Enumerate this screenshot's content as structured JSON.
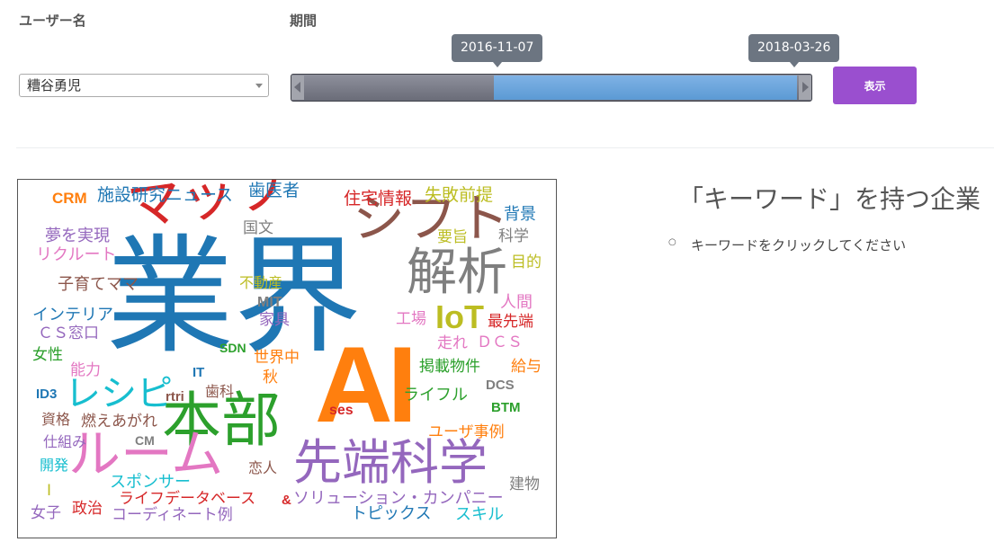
{
  "form": {
    "user_label": "ユーザー名",
    "user_value": "糟谷勇児",
    "period_label": "期間",
    "period_start": "2016-11-07",
    "period_end": "2018-03-26",
    "show_button": "表示"
  },
  "colors": {
    "button": "#9a4fcf",
    "slider_range": "#5b9ad4"
  },
  "panel": {
    "title": "「キーワード」を持つ企業",
    "hint": "キーワードをクリックしてください"
  },
  "cloud_words": [
    {
      "id": "w0",
      "text": "業界",
      "color": "#1f77b4"
    },
    {
      "id": "w1",
      "text": "AI",
      "color": "#ff7f0e"
    },
    {
      "id": "w2",
      "text": "マップ",
      "color": "#d62728"
    },
    {
      "id": "w3",
      "text": "シフト",
      "color": "#8c564b"
    },
    {
      "id": "w4",
      "text": "解析",
      "color": "#7f7f7f"
    },
    {
      "id": "w5",
      "text": "本部",
      "color": "#2ca02c"
    },
    {
      "id": "w6",
      "text": "ルーム",
      "color": "#e377c2"
    },
    {
      "id": "w7",
      "text": "先端科学",
      "color": "#9467bd"
    },
    {
      "id": "w8",
      "text": "IoT",
      "color": "#bcbd22"
    },
    {
      "id": "w9",
      "text": "レシピ",
      "color": "#17becf"
    },
    {
      "id": "w10",
      "text": "CRM",
      "color": "#ff7f0e"
    },
    {
      "id": "w11",
      "text": "施設研究ニュース",
      "color": "#1f77b4"
    },
    {
      "id": "w12",
      "text": "歯医者",
      "color": "#1f77b4"
    },
    {
      "id": "w13",
      "text": "住宅情報",
      "color": "#d62728"
    },
    {
      "id": "w14",
      "text": "失敗前提",
      "color": "#bcbd22"
    },
    {
      "id": "w15",
      "text": "背景",
      "color": "#1f77b4"
    },
    {
      "id": "w16",
      "text": "国文",
      "color": "#7f7f7f"
    },
    {
      "id": "w17",
      "text": "要旨",
      "color": "#bcbd22"
    },
    {
      "id": "w18",
      "text": "科学",
      "color": "#7f7f7f"
    },
    {
      "id": "w19",
      "text": "夢を実現",
      "color": "#9467bd"
    },
    {
      "id": "w20",
      "text": "リクルート",
      "color": "#e377c2"
    },
    {
      "id": "w21",
      "text": "目的",
      "color": "#bcbd22"
    },
    {
      "id": "w22",
      "text": "子育てママ",
      "color": "#8c564b"
    },
    {
      "id": "w23",
      "text": "不動産",
      "color": "#bcbd22"
    },
    {
      "id": "w24",
      "text": "MIT",
      "color": "#7f7f7f"
    },
    {
      "id": "w25",
      "text": "人間",
      "color": "#e377c2"
    },
    {
      "id": "w26",
      "text": "インテリア",
      "color": "#1f77b4"
    },
    {
      "id": "w27",
      "text": "家具",
      "color": "#9467bd"
    },
    {
      "id": "w28",
      "text": "工場",
      "color": "#e377c2"
    },
    {
      "id": "w29",
      "text": "最先端",
      "color": "#d62728"
    },
    {
      "id": "w30",
      "text": "ＣＳ窓口",
      "color": "#9467bd"
    },
    {
      "id": "w31",
      "text": "SDN",
      "color": "#2ca02c"
    },
    {
      "id": "w32",
      "text": "走れ",
      "color": "#e377c2"
    },
    {
      "id": "w33",
      "text": "ＤＣＳ",
      "color": "#e377c2"
    },
    {
      "id": "w34",
      "text": "女性",
      "color": "#2ca02c"
    },
    {
      "id": "w35",
      "text": "世界中",
      "color": "#ff7f0e"
    },
    {
      "id": "w36",
      "text": "能力",
      "color": "#e377c2"
    },
    {
      "id": "w37",
      "text": "IT",
      "color": "#1f77b4"
    },
    {
      "id": "w38",
      "text": "秋",
      "color": "#ff7f0e"
    },
    {
      "id": "w39",
      "text": "掲載物件",
      "color": "#2ca02c"
    },
    {
      "id": "w40",
      "text": "給与",
      "color": "#ff7f0e"
    },
    {
      "id": "w41",
      "text": "ID3",
      "color": "#1f77b4"
    },
    {
      "id": "w42",
      "text": "rtri",
      "color": "#8c564b"
    },
    {
      "id": "w43",
      "text": "歯科",
      "color": "#8c564b"
    },
    {
      "id": "w44",
      "text": "ライフル",
      "color": "#2ca02c"
    },
    {
      "id": "w45",
      "text": "DCS",
      "color": "#7f7f7f"
    },
    {
      "id": "w46",
      "text": "資格",
      "color": "#8c564b"
    },
    {
      "id": "w47",
      "text": "燃えあがれ",
      "color": "#8c564b"
    },
    {
      "id": "w48",
      "text": "ses",
      "color": "#d62728"
    },
    {
      "id": "w49",
      "text": "BTM",
      "color": "#2ca02c"
    },
    {
      "id": "w50",
      "text": "仕組み",
      "color": "#9467bd"
    },
    {
      "id": "w51",
      "text": "CM",
      "color": "#7f7f7f"
    },
    {
      "id": "w52",
      "text": "ユーザ事例",
      "color": "#ff7f0e"
    },
    {
      "id": "w53",
      "text": "開発",
      "color": "#17becf"
    },
    {
      "id": "w54",
      "text": "恋人",
      "color": "#8c564b"
    },
    {
      "id": "w55",
      "text": "スポンサー",
      "color": "#17becf"
    },
    {
      "id": "w56",
      "text": "建物",
      "color": "#7f7f7f"
    },
    {
      "id": "w57",
      "text": "I",
      "color": "#bcbd22"
    },
    {
      "id": "w58",
      "text": "ライフデータベース",
      "color": "#d62728"
    },
    {
      "id": "w59",
      "text": "&",
      "color": "#d62728"
    },
    {
      "id": "w60",
      "text": "ソリューション・カンパニー",
      "color": "#9467bd"
    },
    {
      "id": "w61",
      "text": "女子",
      "color": "#9467bd"
    },
    {
      "id": "w62",
      "text": "政治",
      "color": "#d62728"
    },
    {
      "id": "w63",
      "text": "コーディネート例",
      "color": "#9467bd"
    },
    {
      "id": "w64",
      "text": "トピックス",
      "color": "#1f77b4"
    },
    {
      "id": "w65",
      "text": "スキル",
      "color": "#17becf"
    }
  ]
}
